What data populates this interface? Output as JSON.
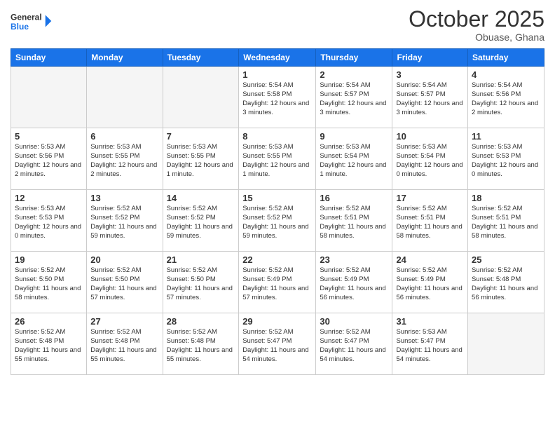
{
  "header": {
    "logo_line1": "General",
    "logo_line2": "Blue",
    "month": "October 2025",
    "location": "Obuase, Ghana"
  },
  "weekdays": [
    "Sunday",
    "Monday",
    "Tuesday",
    "Wednesday",
    "Thursday",
    "Friday",
    "Saturday"
  ],
  "weeks": [
    [
      {
        "day": "",
        "info": ""
      },
      {
        "day": "",
        "info": ""
      },
      {
        "day": "",
        "info": ""
      },
      {
        "day": "1",
        "info": "Sunrise: 5:54 AM\nSunset: 5:58 PM\nDaylight: 12 hours\nand 3 minutes."
      },
      {
        "day": "2",
        "info": "Sunrise: 5:54 AM\nSunset: 5:57 PM\nDaylight: 12 hours\nand 3 minutes."
      },
      {
        "day": "3",
        "info": "Sunrise: 5:54 AM\nSunset: 5:57 PM\nDaylight: 12 hours\nand 3 minutes."
      },
      {
        "day": "4",
        "info": "Sunrise: 5:54 AM\nSunset: 5:56 PM\nDaylight: 12 hours\nand 2 minutes."
      }
    ],
    [
      {
        "day": "5",
        "info": "Sunrise: 5:53 AM\nSunset: 5:56 PM\nDaylight: 12 hours\nand 2 minutes."
      },
      {
        "day": "6",
        "info": "Sunrise: 5:53 AM\nSunset: 5:55 PM\nDaylight: 12 hours\nand 2 minutes."
      },
      {
        "day": "7",
        "info": "Sunrise: 5:53 AM\nSunset: 5:55 PM\nDaylight: 12 hours\nand 1 minute."
      },
      {
        "day": "8",
        "info": "Sunrise: 5:53 AM\nSunset: 5:55 PM\nDaylight: 12 hours\nand 1 minute."
      },
      {
        "day": "9",
        "info": "Sunrise: 5:53 AM\nSunset: 5:54 PM\nDaylight: 12 hours\nand 1 minute."
      },
      {
        "day": "10",
        "info": "Sunrise: 5:53 AM\nSunset: 5:54 PM\nDaylight: 12 hours\nand 0 minutes."
      },
      {
        "day": "11",
        "info": "Sunrise: 5:53 AM\nSunset: 5:53 PM\nDaylight: 12 hours\nand 0 minutes."
      }
    ],
    [
      {
        "day": "12",
        "info": "Sunrise: 5:53 AM\nSunset: 5:53 PM\nDaylight: 12 hours\nand 0 minutes."
      },
      {
        "day": "13",
        "info": "Sunrise: 5:52 AM\nSunset: 5:52 PM\nDaylight: 11 hours\nand 59 minutes."
      },
      {
        "day": "14",
        "info": "Sunrise: 5:52 AM\nSunset: 5:52 PM\nDaylight: 11 hours\nand 59 minutes."
      },
      {
        "day": "15",
        "info": "Sunrise: 5:52 AM\nSunset: 5:52 PM\nDaylight: 11 hours\nand 59 minutes."
      },
      {
        "day": "16",
        "info": "Sunrise: 5:52 AM\nSunset: 5:51 PM\nDaylight: 11 hours\nand 58 minutes."
      },
      {
        "day": "17",
        "info": "Sunrise: 5:52 AM\nSunset: 5:51 PM\nDaylight: 11 hours\nand 58 minutes."
      },
      {
        "day": "18",
        "info": "Sunrise: 5:52 AM\nSunset: 5:51 PM\nDaylight: 11 hours\nand 58 minutes."
      }
    ],
    [
      {
        "day": "19",
        "info": "Sunrise: 5:52 AM\nSunset: 5:50 PM\nDaylight: 11 hours\nand 58 minutes."
      },
      {
        "day": "20",
        "info": "Sunrise: 5:52 AM\nSunset: 5:50 PM\nDaylight: 11 hours\nand 57 minutes."
      },
      {
        "day": "21",
        "info": "Sunrise: 5:52 AM\nSunset: 5:50 PM\nDaylight: 11 hours\nand 57 minutes."
      },
      {
        "day": "22",
        "info": "Sunrise: 5:52 AM\nSunset: 5:49 PM\nDaylight: 11 hours\nand 57 minutes."
      },
      {
        "day": "23",
        "info": "Sunrise: 5:52 AM\nSunset: 5:49 PM\nDaylight: 11 hours\nand 56 minutes."
      },
      {
        "day": "24",
        "info": "Sunrise: 5:52 AM\nSunset: 5:49 PM\nDaylight: 11 hours\nand 56 minutes."
      },
      {
        "day": "25",
        "info": "Sunrise: 5:52 AM\nSunset: 5:48 PM\nDaylight: 11 hours\nand 56 minutes."
      }
    ],
    [
      {
        "day": "26",
        "info": "Sunrise: 5:52 AM\nSunset: 5:48 PM\nDaylight: 11 hours\nand 55 minutes."
      },
      {
        "day": "27",
        "info": "Sunrise: 5:52 AM\nSunset: 5:48 PM\nDaylight: 11 hours\nand 55 minutes."
      },
      {
        "day": "28",
        "info": "Sunrise: 5:52 AM\nSunset: 5:48 PM\nDaylight: 11 hours\nand 55 minutes."
      },
      {
        "day": "29",
        "info": "Sunrise: 5:52 AM\nSunset: 5:47 PM\nDaylight: 11 hours\nand 54 minutes."
      },
      {
        "day": "30",
        "info": "Sunrise: 5:52 AM\nSunset: 5:47 PM\nDaylight: 11 hours\nand 54 minutes."
      },
      {
        "day": "31",
        "info": "Sunrise: 5:53 AM\nSunset: 5:47 PM\nDaylight: 11 hours\nand 54 minutes."
      },
      {
        "day": "",
        "info": ""
      }
    ]
  ]
}
